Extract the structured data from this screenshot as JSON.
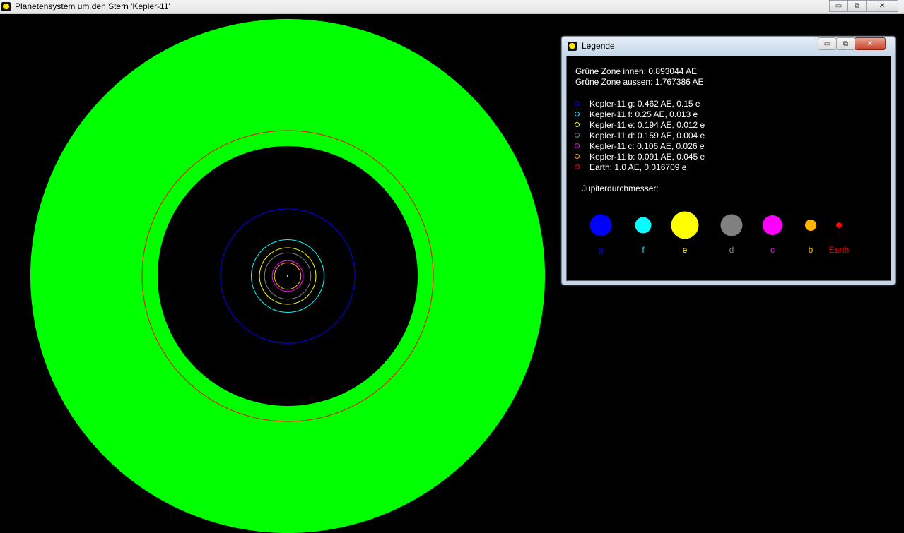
{
  "main_window": {
    "title": "Planetensystem um den Stern 'Kepler-11'",
    "controls": {
      "minimize": "▭",
      "maximize": "⧉",
      "close": "✕"
    }
  },
  "colors": {
    "habitable_zone": "#00ff00",
    "background": "#000000"
  },
  "orbit_plot": {
    "habitable_zone_inner_au": 0.893044,
    "habitable_zone_outer_au": 1.767386,
    "orbits": [
      {
        "name": "Kepler-11 g",
        "a_au": 0.462,
        "e": 0.15,
        "color": "#0000ff"
      },
      {
        "name": "Kepler-11 f",
        "a_au": 0.25,
        "e": 0.013,
        "color": "#00ffff"
      },
      {
        "name": "Kepler-11 e",
        "a_au": 0.194,
        "e": 0.012,
        "color": "#ffff00"
      },
      {
        "name": "Kepler-11 d",
        "a_au": 0.159,
        "e": 0.004,
        "color": "#808080"
      },
      {
        "name": "Kepler-11 c",
        "a_au": 0.106,
        "e": 0.026,
        "color": "#ff00ff"
      },
      {
        "name": "Kepler-11 b",
        "a_au": 0.091,
        "e": 0.045,
        "color": "#ffb400"
      },
      {
        "name": "Earth",
        "a_au": 1.0,
        "e": 0.016709,
        "color": "#ff0000"
      }
    ]
  },
  "legend_window": {
    "title": "Legende",
    "controls": {
      "minimize": "▭",
      "maximize": "⧉",
      "close": "✕"
    },
    "zone_inner": "Grüne Zone innen: 0.893044 AE",
    "zone_outer": "Grüne Zone aussen: 1.767386 AE",
    "planets": [
      {
        "label": "Kepler-11 g: 0.462 AE, 0.15 e",
        "color": "#0000ff"
      },
      {
        "label": "Kepler-11 f: 0.25 AE, 0.013 e",
        "color": "#00ffff"
      },
      {
        "label": "Kepler-11 e: 0.194 AE, 0.012 e",
        "color": "#ffff00"
      },
      {
        "label": "Kepler-11 d: 0.159 AE, 0.004 e",
        "color": "#808080"
      },
      {
        "label": "Kepler-11 c: 0.106 AE, 0.026 e",
        "color": "#ff00ff"
      },
      {
        "label": "Kepler-11 b: 0.091 AE, 0.045 e",
        "color": "#ffb400"
      },
      {
        "label": "Earth: 1.0 AE, 0.016709 e",
        "color": "#ff0000"
      }
    ],
    "diameter_heading": "Jupiterdurchmesser:",
    "sizes": [
      {
        "label": "g",
        "color": "#0000ff"
      },
      {
        "label": "f",
        "color": "#00ffff"
      },
      {
        "label": "e",
        "color": "#ffff00"
      },
      {
        "label": "d",
        "color": "#808080"
      },
      {
        "label": "c",
        "color": "#ff00ff"
      },
      {
        "label": "b",
        "color": "#ffb400"
      },
      {
        "label": "Earth",
        "color": "#ff0000"
      }
    ]
  }
}
